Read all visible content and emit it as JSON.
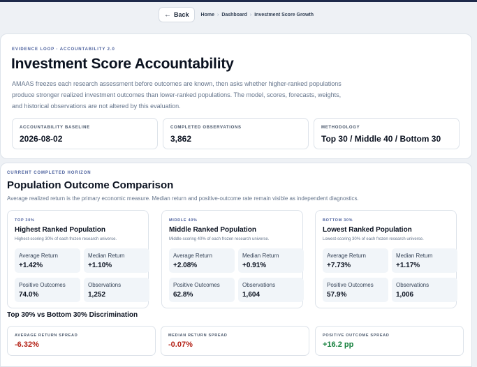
{
  "nav": {
    "back_label": "Back",
    "breadcrumbs": [
      "Home",
      "Dashboard",
      "Investment Score Growth"
    ]
  },
  "header": {
    "eyebrow": "EVIDENCE LOOP · ACCOUNTABILITY 2.0",
    "title": "Investment Score Accountability",
    "lead": [
      "AMAAS freezes each research assessment before outcomes are known, then asks whether higher-ranked populations",
      "produce stronger realized investment outcomes than lower-ranked populations. The model, scores, forecasts, weights,",
      "and historical observations are not altered by this evaluation."
    ],
    "stats": [
      {
        "label": "ACCOUNTABILITY BASELINE",
        "value": "2026-08-02"
      },
      {
        "label": "COMPLETED OBSERVATIONS",
        "value": "3,862"
      },
      {
        "label": "METHODOLOGY",
        "value": "Top 30 / Middle 40 / Bottom 30"
      }
    ]
  },
  "comparison": {
    "eyebrow": "CURRENT COMPLETED HORIZON",
    "title": "Population Outcome Comparison",
    "subtitle": "Average realized return is the primary economic measure. Median return and positive-outcome rate remain visible as independent diagnostics.",
    "populations": [
      {
        "tag": "TOP 30%",
        "title": "Highest Ranked Population",
        "desc": "Highest-scoring 30% of each frozen research universe.",
        "metrics": [
          {
            "label": "Average Return",
            "value": "+1.42%"
          },
          {
            "label": "Median Return",
            "value": "+1.10%"
          },
          {
            "label": "Positive Outcomes",
            "value": "74.0%"
          },
          {
            "label": "Observations",
            "value": "1,252"
          }
        ]
      },
      {
        "tag": "MIDDLE 40%",
        "title": "Middle Ranked Population",
        "desc": "Middle-scoring 40% of each frozen research universe.",
        "metrics": [
          {
            "label": "Average Return",
            "value": "+2.08%"
          },
          {
            "label": "Median Return",
            "value": "+0.91%"
          },
          {
            "label": "Positive Outcomes",
            "value": "62.8%"
          },
          {
            "label": "Observations",
            "value": "1,604"
          }
        ]
      },
      {
        "tag": "BOTTOM 30%",
        "title": "Lowest Ranked Population",
        "desc": "Lowest-scoring 30% of each frozen research universe.",
        "metrics": [
          {
            "label": "Average Return",
            "value": "+7.73%"
          },
          {
            "label": "Median Return",
            "value": "+1.17%"
          },
          {
            "label": "Positive Outcomes",
            "value": "57.9%"
          },
          {
            "label": "Observations",
            "value": "1,006"
          }
        ]
      }
    ],
    "discrimination_title": "Top 30% vs Bottom 30% Discrimination",
    "spreads": [
      {
        "label": "AVERAGE RETURN SPREAD",
        "value": "-6.32%",
        "color": "#b42318"
      },
      {
        "label": "MEDIAN RETURN SPREAD",
        "value": "-0.07%",
        "color": "#b42318"
      },
      {
        "label": "POSITIVE OUTCOME SPREAD",
        "value": "+16.2 pp",
        "color": "#15803d"
      }
    ]
  }
}
